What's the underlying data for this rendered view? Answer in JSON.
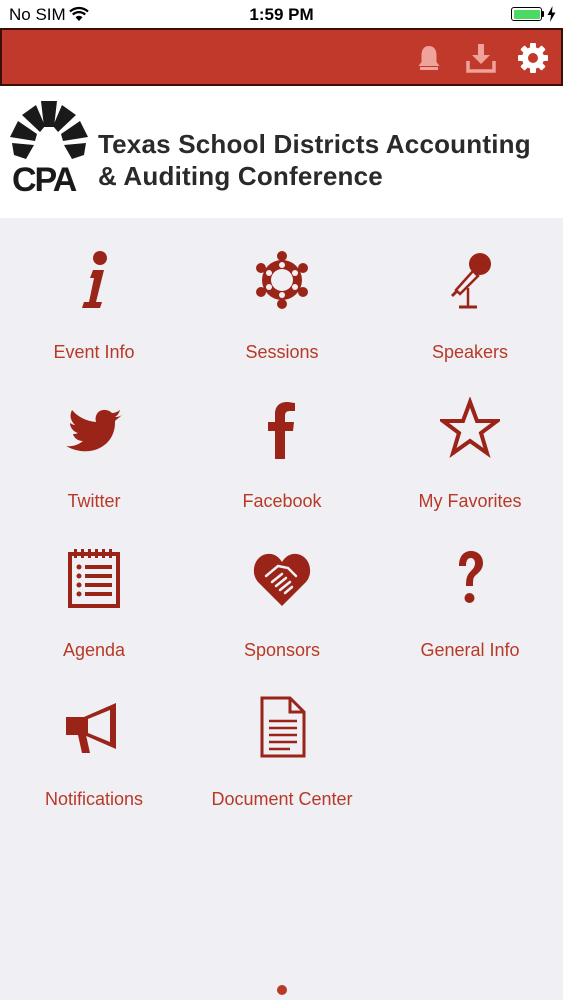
{
  "status_bar": {
    "carrier": "No SIM",
    "time": "1:59 PM",
    "battery_color": "#4cd964"
  },
  "toolbar": {
    "background_color": "#c0392b",
    "icons": [
      "bell-icon",
      "download-icon",
      "gear-icon"
    ]
  },
  "banner": {
    "logo_text": "CPA",
    "title_line1": "Texas School Districts Accounting",
    "title_line2": "& Auditing Conference"
  },
  "menu": {
    "accent_color": "#b83a26",
    "items": [
      {
        "label": "Event Info",
        "icon": "info-icon"
      },
      {
        "label": "Sessions",
        "icon": "sessions-icon"
      },
      {
        "label": "Speakers",
        "icon": "microphone-icon"
      },
      {
        "label": "Twitter",
        "icon": "twitter-bird-icon"
      },
      {
        "label": "Facebook",
        "icon": "facebook-icon"
      },
      {
        "label": "My Favorites",
        "icon": "star-icon"
      },
      {
        "label": "Agenda",
        "icon": "agenda-list-icon"
      },
      {
        "label": "Sponsors",
        "icon": "handshake-heart-icon"
      },
      {
        "label": "General Info",
        "icon": "question-mark-icon"
      },
      {
        "label": "Notifications",
        "icon": "megaphone-icon"
      },
      {
        "label": "Document Center",
        "icon": "document-icon"
      }
    ]
  },
  "pager": {
    "current_page": 1,
    "page_count": 1
  }
}
